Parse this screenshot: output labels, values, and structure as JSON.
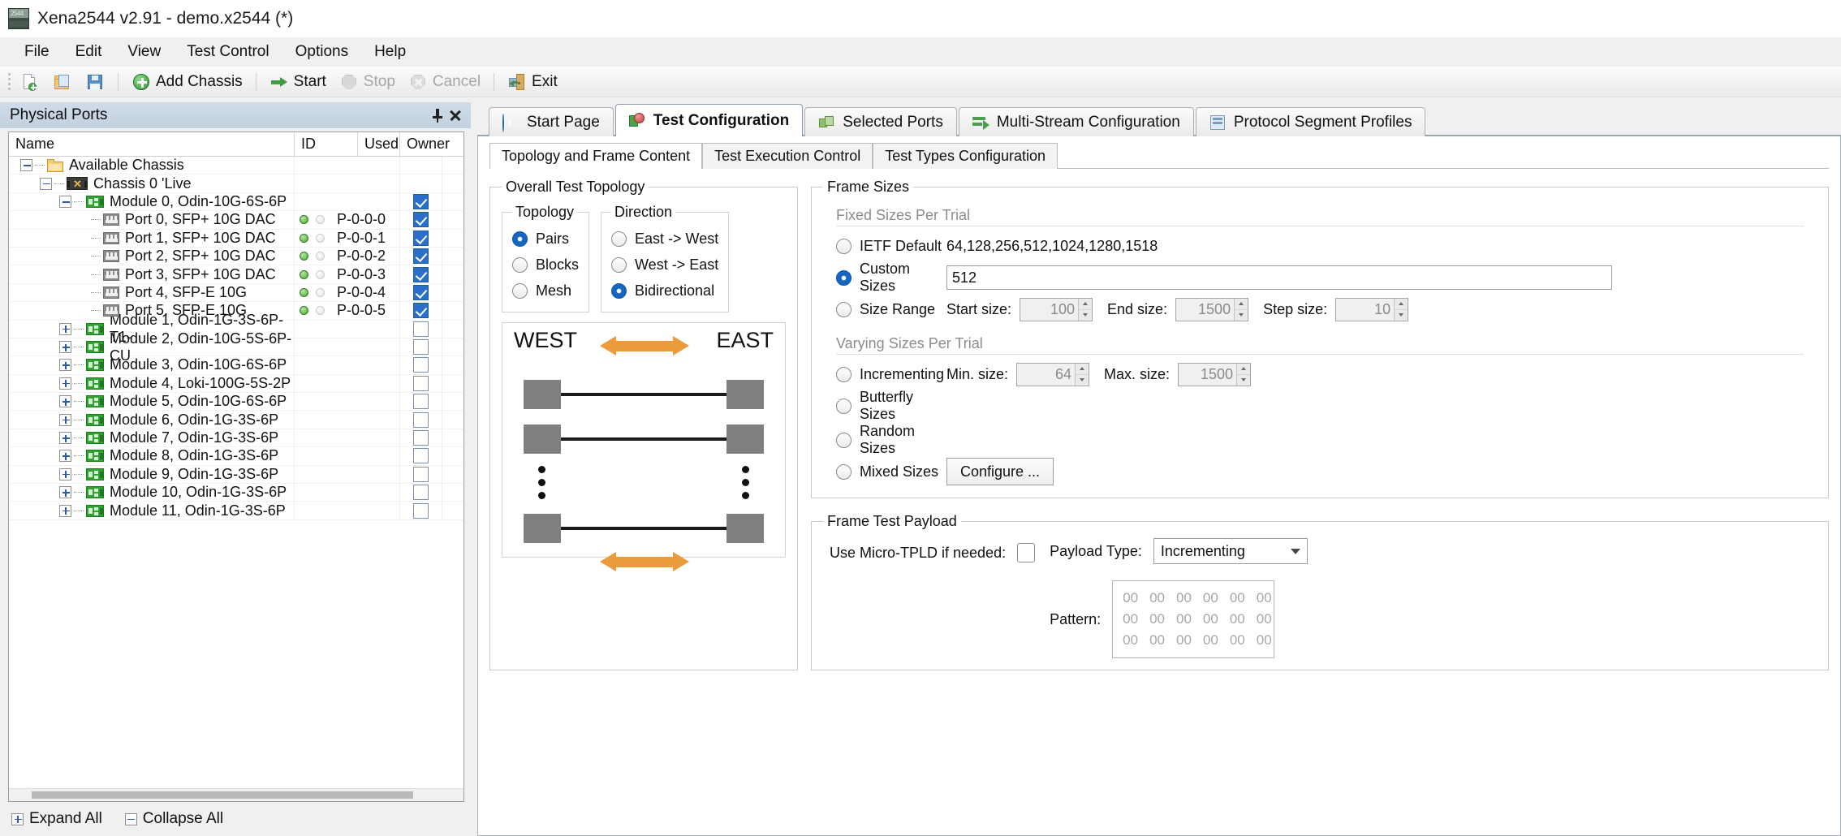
{
  "window": {
    "title": "Xena2544 v2.91 - demo.x2544 (*)",
    "icon": "xena-app-icon"
  },
  "menubar": {
    "items": [
      {
        "label": "File"
      },
      {
        "label": "Edit"
      },
      {
        "label": "View"
      },
      {
        "label": "Test Control"
      },
      {
        "label": "Options"
      },
      {
        "label": "Help"
      }
    ]
  },
  "toolbar": {
    "new_label": "",
    "open_label": "",
    "save_label": "",
    "add_chassis_label": "Add Chassis",
    "start_label": "Start",
    "stop_label": "Stop",
    "cancel_label": "Cancel",
    "exit_label": "Exit"
  },
  "dock": {
    "caption": "Physical Ports",
    "columns": {
      "name": "Name",
      "id": "ID",
      "used": "Used",
      "owner": "Owner"
    },
    "rows": [
      {
        "label": "Available Chassis",
        "type": "folder",
        "depth": 0,
        "expander": "minus",
        "id": "",
        "used": null,
        "leds": null
      },
      {
        "label": "Chassis 0 'Live",
        "type": "chassis",
        "depth": 1,
        "expander": "minus",
        "id": "",
        "used": null,
        "leds": null
      },
      {
        "label": "Module 0, Odin-10G-6S-6P",
        "type": "module",
        "depth": 2,
        "expander": "minus",
        "id": "",
        "used": true,
        "leds": null
      },
      {
        "label": "Port 0, SFP+ 10G DAC",
        "type": "port",
        "depth": 3,
        "expander": "none",
        "id": "P-0-0-0",
        "used": true,
        "leds": [
          "green",
          "off"
        ]
      },
      {
        "label": "Port 1, SFP+ 10G DAC",
        "type": "port",
        "depth": 3,
        "expander": "none",
        "id": "P-0-0-1",
        "used": true,
        "leds": [
          "green",
          "off"
        ]
      },
      {
        "label": "Port 2, SFP+ 10G DAC",
        "type": "port",
        "depth": 3,
        "expander": "none",
        "id": "P-0-0-2",
        "used": true,
        "leds": [
          "green",
          "off"
        ]
      },
      {
        "label": "Port 3, SFP+ 10G DAC",
        "type": "port",
        "depth": 3,
        "expander": "none",
        "id": "P-0-0-3",
        "used": true,
        "leds": [
          "green",
          "off"
        ]
      },
      {
        "label": "Port 4, SFP-E 10G",
        "type": "port",
        "depth": 3,
        "expander": "none",
        "id": "P-0-0-4",
        "used": true,
        "leds": [
          "green",
          "off"
        ]
      },
      {
        "label": "Port 5, SFP-E 10G",
        "type": "port",
        "depth": 3,
        "expander": "none",
        "id": "P-0-0-5",
        "used": true,
        "leds": [
          "green",
          "off"
        ]
      },
      {
        "label": "Module 1, Odin-1G-3S-6P-T1-",
        "type": "module",
        "depth": 2,
        "expander": "plus",
        "id": "",
        "used": false,
        "leds": null
      },
      {
        "label": "Module 2, Odin-10G-5S-6P-CU",
        "type": "module",
        "depth": 2,
        "expander": "plus",
        "id": "",
        "used": false,
        "leds": null
      },
      {
        "label": "Module 3, Odin-10G-6S-6P",
        "type": "module",
        "depth": 2,
        "expander": "plus",
        "id": "",
        "used": false,
        "leds": null
      },
      {
        "label": "Module 4, Loki-100G-5S-2P",
        "type": "module",
        "depth": 2,
        "expander": "plus",
        "id": "",
        "used": false,
        "leds": null
      },
      {
        "label": "Module 5, Odin-10G-6S-6P",
        "type": "module",
        "depth": 2,
        "expander": "plus",
        "id": "",
        "used": false,
        "leds": null
      },
      {
        "label": "Module 6, Odin-1G-3S-6P",
        "type": "module",
        "depth": 2,
        "expander": "plus",
        "id": "",
        "used": false,
        "leds": null
      },
      {
        "label": "Module 7, Odin-1G-3S-6P",
        "type": "module",
        "depth": 2,
        "expander": "plus",
        "id": "",
        "used": false,
        "leds": null
      },
      {
        "label": "Module 8, Odin-1G-3S-6P",
        "type": "module",
        "depth": 2,
        "expander": "plus",
        "id": "",
        "used": false,
        "leds": null
      },
      {
        "label": "Module 9, Odin-1G-3S-6P",
        "type": "module",
        "depth": 2,
        "expander": "plus",
        "id": "",
        "used": false,
        "leds": null
      },
      {
        "label": "Module 10, Odin-1G-3S-6P",
        "type": "module",
        "depth": 2,
        "expander": "plus",
        "id": "",
        "used": false,
        "leds": null
      },
      {
        "label": "Module 11, Odin-1G-3S-6P",
        "type": "module",
        "depth": 2,
        "expander": "plus",
        "id": "",
        "used": false,
        "leds": null
      }
    ],
    "footer": {
      "expand_all": "Expand All",
      "collapse_all": "Collapse All"
    }
  },
  "tabs": [
    {
      "label": "Start Page",
      "icon": "info-icon",
      "active": false
    },
    {
      "label": "Test Configuration",
      "icon": "test-config-icon",
      "active": true
    },
    {
      "label": "Selected Ports",
      "icon": "ports-icon",
      "active": false
    },
    {
      "label": "Multi-Stream Configuration",
      "icon": "multistream-icon",
      "active": false
    },
    {
      "label": "Protocol Segment Profiles",
      "icon": "segment-icon",
      "active": false
    }
  ],
  "subtabs": [
    {
      "label": "Topology and Frame Content",
      "active": true
    },
    {
      "label": "Test Execution Control",
      "active": false
    },
    {
      "label": "Test Types Configuration",
      "active": false
    }
  ],
  "topology": {
    "group_title": "Overall Test Topology",
    "topology_group": "Topology",
    "topology_options": [
      {
        "label": "Pairs",
        "selected": true
      },
      {
        "label": "Blocks",
        "selected": false
      },
      {
        "label": "Mesh",
        "selected": false
      }
    ],
    "direction_group": "Direction",
    "direction_options": [
      {
        "label": "East -> West",
        "selected": false
      },
      {
        "label": "West -> East",
        "selected": false
      },
      {
        "label": "Bidirectional",
        "selected": true
      }
    ],
    "diagram": {
      "west_label": "WEST",
      "east_label": "EAST"
    }
  },
  "frame_sizes": {
    "group_title": "Frame Sizes",
    "fixed_caption": "Fixed Sizes Per Trial",
    "ietf": {
      "label": "IETF Default",
      "selected": false,
      "value": "64,128,256,512,1024,1280,1518"
    },
    "custom": {
      "label": "Custom Sizes",
      "selected": true,
      "value": "512"
    },
    "size_range": {
      "label": "Size Range",
      "selected": false,
      "start_label": "Start size:",
      "start_value": "100",
      "end_label": "End size:",
      "end_value": "1500",
      "step_label": "Step size:",
      "step_value": "10"
    },
    "varying_caption": "Varying Sizes Per Trial",
    "incrementing": {
      "label": "Incrementing",
      "selected": false,
      "min_label": "Min. size:",
      "min_value": "64",
      "max_label": "Max. size:",
      "max_value": "1500"
    },
    "butterfly": {
      "label": "Butterfly Sizes",
      "selected": false
    },
    "random": {
      "label": "Random Sizes",
      "selected": false
    },
    "mixed": {
      "label": "Mixed Sizes",
      "selected": false,
      "configure_label": "Configure ..."
    }
  },
  "payload": {
    "group_title": "Frame Test Payload",
    "micro_tpld_label": "Use Micro-TPLD if needed:",
    "micro_tpld_checked": false,
    "payload_type_label": "Payload Type:",
    "payload_type_value": "Incrementing",
    "pattern_label": "Pattern:",
    "pattern_rows": [
      [
        "00",
        "00",
        "00",
        "00",
        "00",
        "00"
      ],
      [
        "00",
        "00",
        "00",
        "00",
        "00",
        "00"
      ],
      [
        "00",
        "00",
        "00",
        "00",
        "00",
        "00"
      ]
    ]
  },
  "colors": {
    "accent": "#1566c0",
    "arrow": "#eb9b3c",
    "led_green": "#49a832"
  }
}
